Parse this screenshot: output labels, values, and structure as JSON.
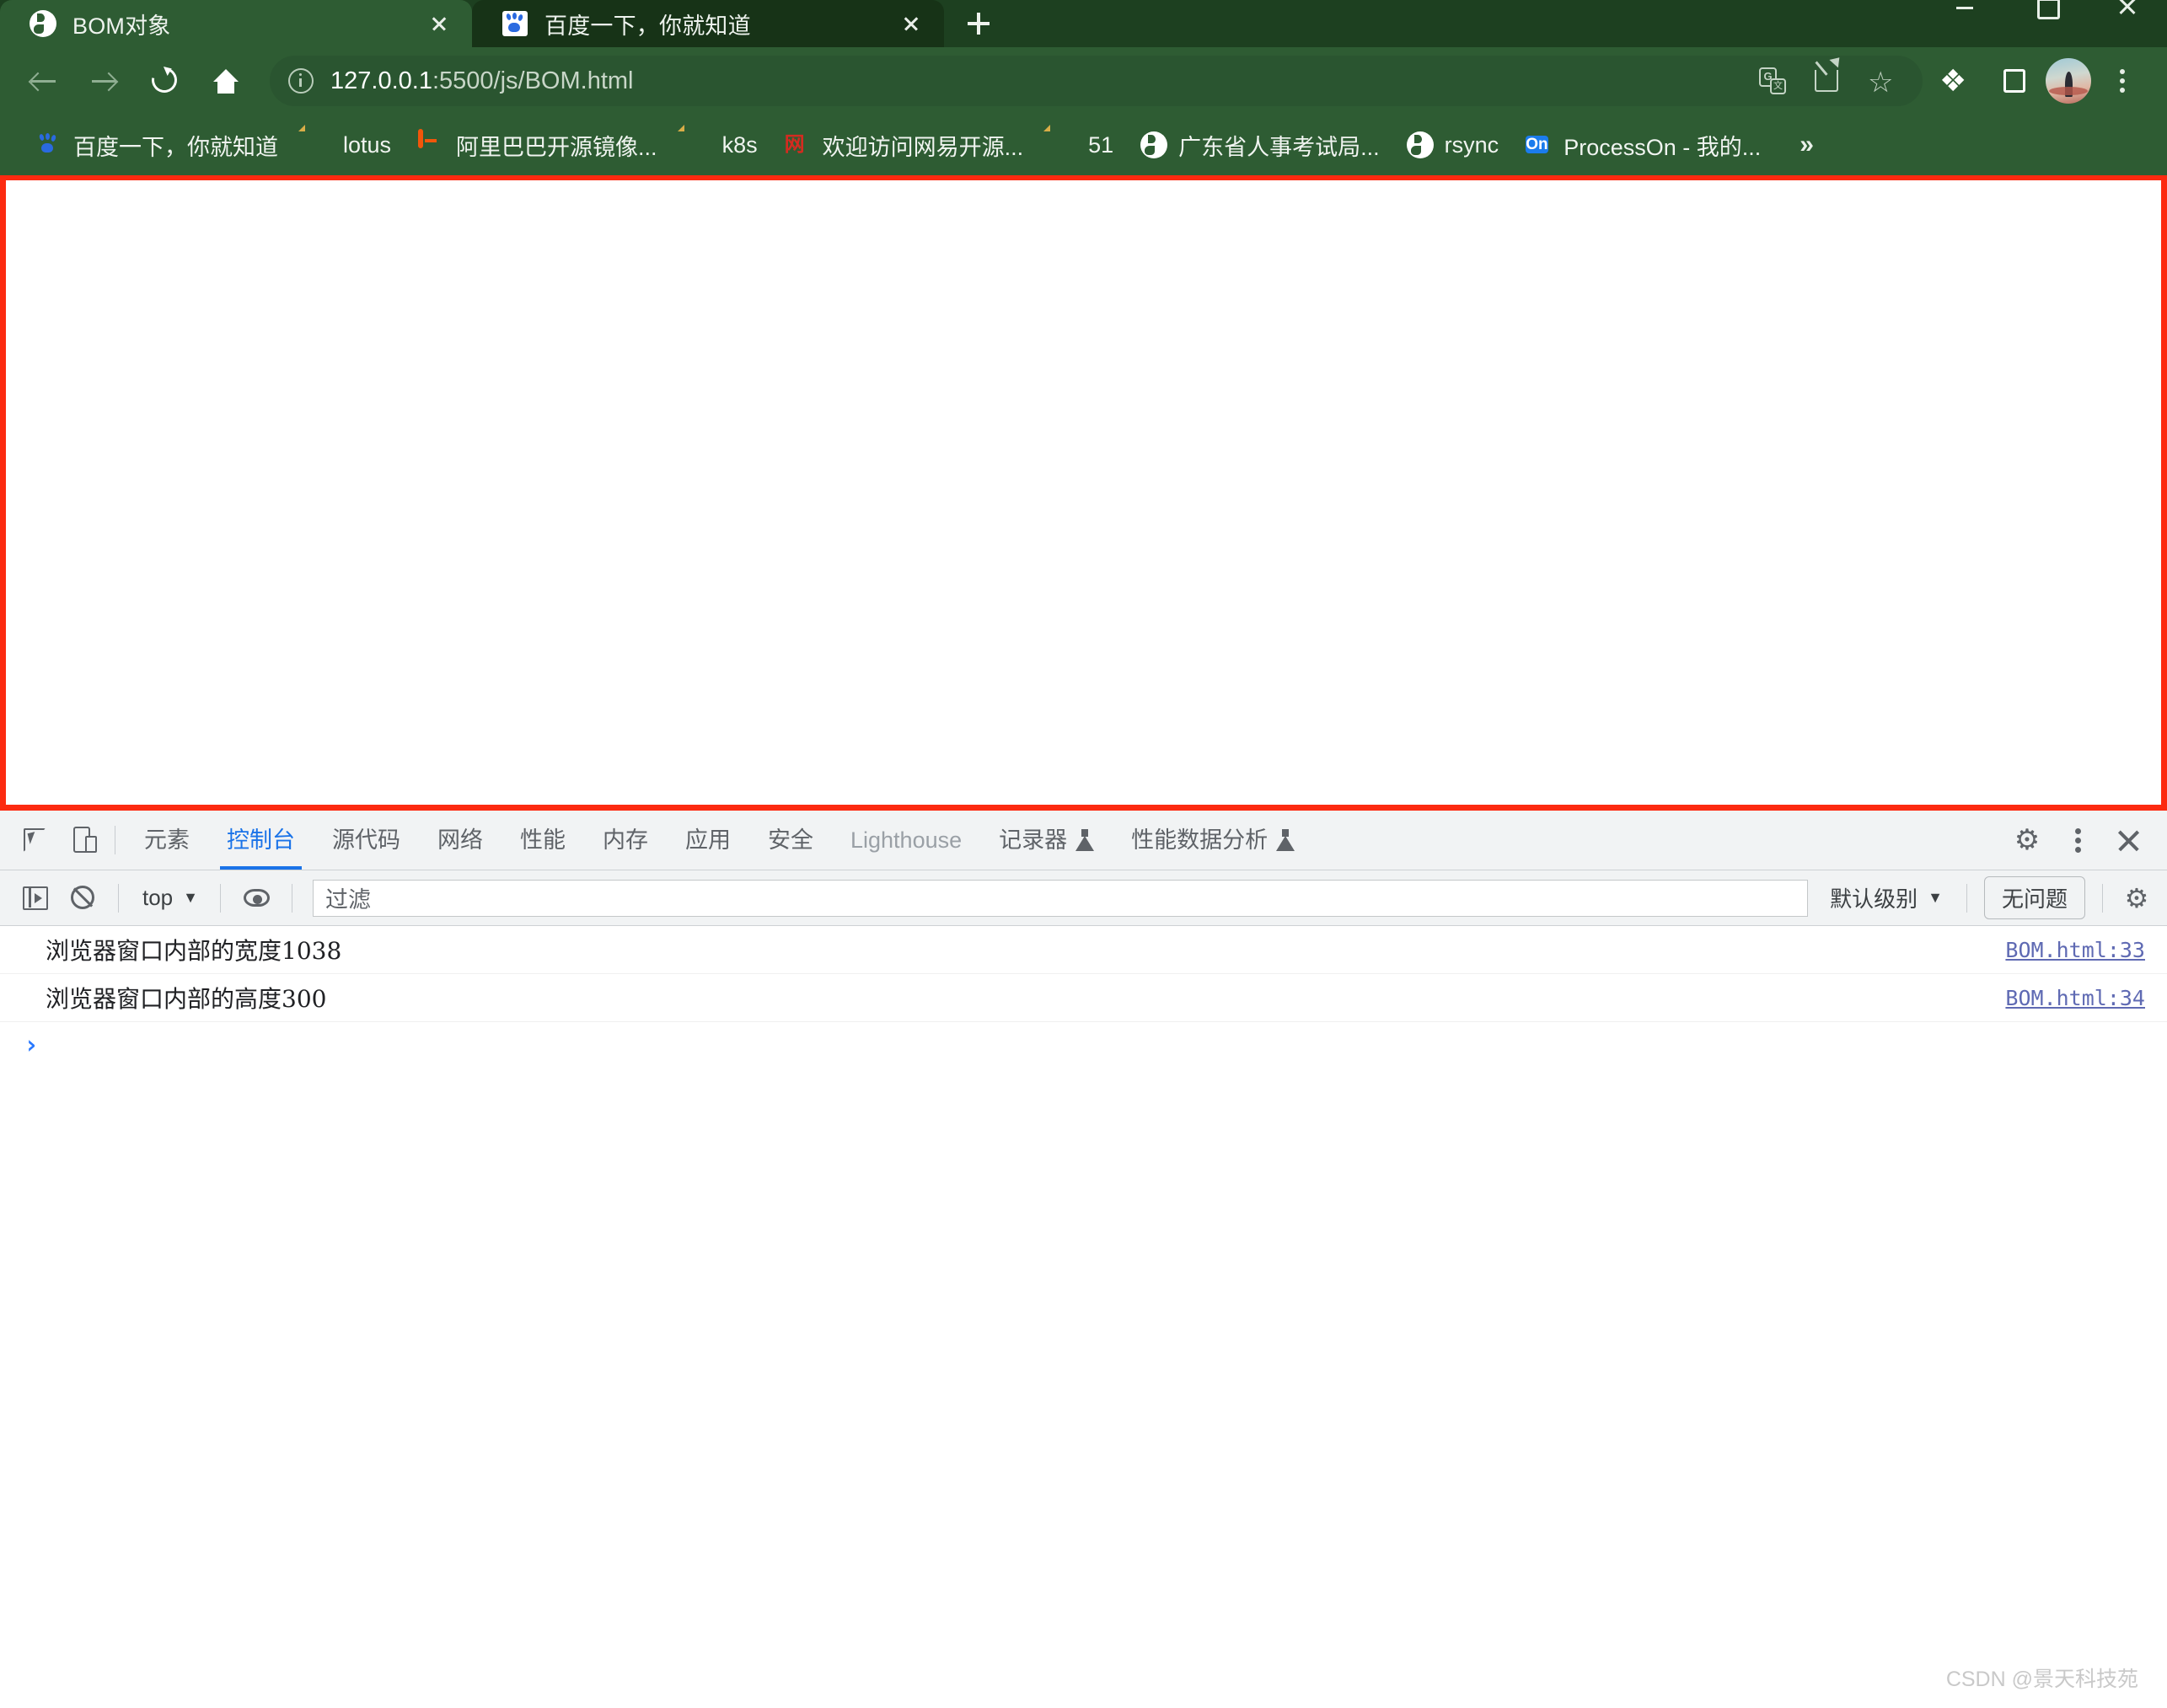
{
  "window": {
    "controls": [
      {
        "name": "minimize",
        "label": "–"
      },
      {
        "name": "maximize",
        "label": "□"
      },
      {
        "name": "close",
        "label": "✕"
      }
    ]
  },
  "tabs": [
    {
      "title": "BOM对象",
      "favicon": "globe-icon",
      "active": true
    },
    {
      "title": "百度一下，你就知道",
      "favicon": "baidu-icon",
      "active": false
    }
  ],
  "newtab_tooltip": "+",
  "toolbar": {
    "back_icon": "back-arrow-icon",
    "forward_icon": "forward-arrow-icon",
    "reload_icon": "reload-icon",
    "home_icon": "home-icon",
    "security_icon": "info-circle-icon",
    "url_host": "127.0.0.1",
    "url_path": ":5500/js/BOM.html",
    "url_full": "127.0.0.1:5500/js/BOM.html",
    "translate_letter": "G",
    "translate_letter2": "文",
    "puzzle_glyph": "❖",
    "actions": [
      "translate-icon",
      "share-icon",
      "bookmark-star-icon",
      "extensions-icon",
      "side-panel-icon",
      "avatar",
      "browser-menu-icon"
    ]
  },
  "bookmarks": {
    "items": [
      {
        "label": "百度一下，你就知道",
        "icon": "baidu-icon"
      },
      {
        "label": "lotus",
        "icon": "folder-icon"
      },
      {
        "label": "阿里巴巴开源镜像...",
        "icon": "alibaba-mirror-icon"
      },
      {
        "label": "k8s",
        "icon": "folder-icon"
      },
      {
        "label": "欢迎访问网易开源...",
        "icon": "netease-icon"
      },
      {
        "label": "51",
        "icon": "folder-icon"
      },
      {
        "label": "广东省人事考试局...",
        "icon": "globe-icon"
      },
      {
        "label": "rsync",
        "icon": "globe-icon"
      },
      {
        "label": "ProcessOn - 我的...",
        "icon": "processon-icon"
      }
    ],
    "overflow_label": "»",
    "netease_glyph": "网"
  },
  "viewport": {
    "content": "",
    "highlight_color": "#fc2a10"
  },
  "devtools": {
    "inspect_icon": "inspect-element-icon",
    "device_icon": "device-toolbar-icon",
    "tabs": [
      {
        "label": "元素",
        "active": false,
        "dim": false,
        "flask": false
      },
      {
        "label": "控制台",
        "active": true,
        "dim": false,
        "flask": false
      },
      {
        "label": "源代码",
        "active": false,
        "dim": false,
        "flask": false
      },
      {
        "label": "网络",
        "active": false,
        "dim": false,
        "flask": false
      },
      {
        "label": "性能",
        "active": false,
        "dim": false,
        "flask": false
      },
      {
        "label": "内存",
        "active": false,
        "dim": false,
        "flask": false
      },
      {
        "label": "应用",
        "active": false,
        "dim": false,
        "flask": false
      },
      {
        "label": "安全",
        "active": false,
        "dim": false,
        "flask": false
      },
      {
        "label": "Lighthouse",
        "active": false,
        "dim": true,
        "flask": false
      },
      {
        "label": "记录器",
        "active": false,
        "dim": false,
        "flask": true
      },
      {
        "label": "性能数据分析",
        "active": false,
        "dim": false,
        "flask": true
      }
    ],
    "right_actions": [
      "settings-gear-icon",
      "more-options-icon",
      "close-devtools-icon"
    ],
    "gear_glyph": "⚙",
    "console_toolbar": {
      "sidebar_icon": "console-sidebar-icon",
      "clear_icon": "clear-console-icon",
      "context": "top",
      "context_caret": "▼",
      "eye_icon": "live-expression-icon",
      "filter_placeholder": "过滤",
      "filter_value": "",
      "level": "默认级别",
      "level_caret": "▼",
      "issues": "无问题",
      "settings_icon": "console-settings-icon"
    },
    "logs": [
      {
        "text": "浏览器窗口内部的宽度1038",
        "source": "BOM.html:33"
      },
      {
        "text": "浏览器窗口内部的高度300",
        "source": "BOM.html:34"
      }
    ],
    "prompt_glyph": "›",
    "prompt_value": ""
  },
  "watermark": "CSDN @景天科技苑"
}
